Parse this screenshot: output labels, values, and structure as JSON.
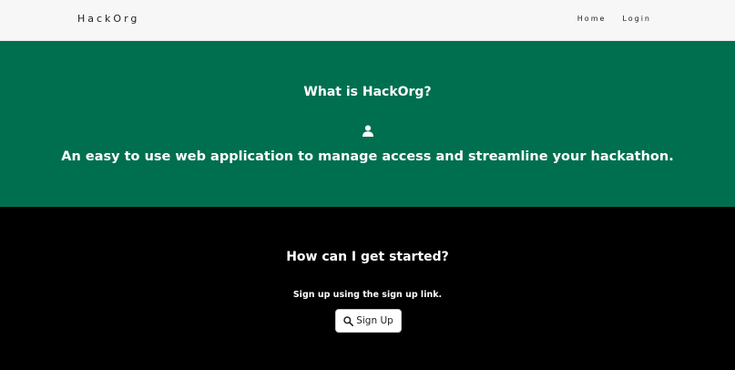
{
  "nav": {
    "brand": "HackOrg",
    "links": [
      {
        "label": "Home"
      },
      {
        "label": "Login"
      }
    ]
  },
  "hero": {
    "title": "What is HackOrg?",
    "icon": "user-icon",
    "tagline": "An easy to use web application to manage access and streamline your hackathon."
  },
  "getstarted": {
    "title": "How can I get started?",
    "text": "Sign up using the sign up link.",
    "button_label": "Sign Up",
    "button_icon": "search-icon"
  },
  "colors": {
    "nav_bg": "#f7f7f7",
    "hero_bg": "#006f4f",
    "section_bg": "#000000",
    "text_light": "#ffffff"
  }
}
